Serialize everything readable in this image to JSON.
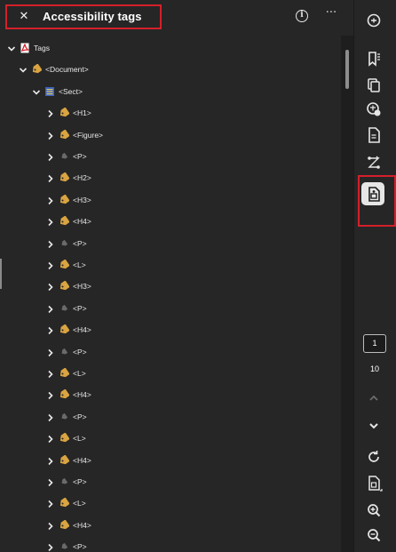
{
  "panel": {
    "title": "Accessibility tags",
    "close_icon": "close-icon",
    "info_icon": "info-icon",
    "info_glyph": "i",
    "more_icon": "more-options-icon",
    "more_glyph": "···",
    "highlight_color": "#d4202a"
  },
  "tree": {
    "rows": [
      {
        "label": "Tags",
        "icon": "pdf-tags-icon",
        "level": 0,
        "expanded": true
      },
      {
        "label": "<Document>",
        "icon": "tag-icon",
        "level": 1,
        "expanded": true
      },
      {
        "label": "<Sect>",
        "icon": "section-icon",
        "level": 2,
        "expanded": true
      },
      {
        "label": "<H1>",
        "icon": "tag-icon",
        "level": 3,
        "expanded": false
      },
      {
        "label": "<Figure>",
        "icon": "tag-icon",
        "level": 3,
        "expanded": false
      },
      {
        "label": "<P>",
        "icon": "tag-dim-icon",
        "level": 3,
        "expanded": false
      },
      {
        "label": "<H2>",
        "icon": "tag-icon",
        "level": 3,
        "expanded": false
      },
      {
        "label": "<H3>",
        "icon": "tag-icon",
        "level": 3,
        "expanded": false
      },
      {
        "label": "<H4>",
        "icon": "tag-icon",
        "level": 3,
        "expanded": false
      },
      {
        "label": "<P>",
        "icon": "tag-dim-icon",
        "level": 3,
        "expanded": false
      },
      {
        "label": "<L>",
        "icon": "tag-icon",
        "level": 3,
        "expanded": false
      },
      {
        "label": "<H3>",
        "icon": "tag-icon",
        "level": 3,
        "expanded": false
      },
      {
        "label": "<P>",
        "icon": "tag-dim-icon",
        "level": 3,
        "expanded": false
      },
      {
        "label": "<H4>",
        "icon": "tag-icon",
        "level": 3,
        "expanded": false
      },
      {
        "label": "<P>",
        "icon": "tag-dim-icon",
        "level": 3,
        "expanded": false
      },
      {
        "label": "<L>",
        "icon": "tag-icon",
        "level": 3,
        "expanded": false
      },
      {
        "label": "<H4>",
        "icon": "tag-icon",
        "level": 3,
        "expanded": false
      },
      {
        "label": "<P>",
        "icon": "tag-dim-icon",
        "level": 3,
        "expanded": false
      },
      {
        "label": "<L>",
        "icon": "tag-icon",
        "level": 3,
        "expanded": false
      },
      {
        "label": "<H4>",
        "icon": "tag-icon",
        "level": 3,
        "expanded": false
      },
      {
        "label": "<P>",
        "icon": "tag-dim-icon",
        "level": 3,
        "expanded": false
      },
      {
        "label": "<L>",
        "icon": "tag-icon",
        "level": 3,
        "expanded": false
      },
      {
        "label": "<H4>",
        "icon": "tag-icon",
        "level": 3,
        "expanded": false
      },
      {
        "label": "<P>",
        "icon": "tag-dim-icon",
        "level": 3,
        "expanded": false
      }
    ]
  },
  "toolbar": {
    "buttons": [
      {
        "name": "comment-icon"
      },
      {
        "name": "bookmarks-icon"
      },
      {
        "name": "copy-pages-icon"
      },
      {
        "name": "attachments-icon"
      },
      {
        "name": "document-properties-icon"
      },
      {
        "name": "order-icon"
      },
      {
        "name": "accessibility-tags-icon",
        "active": true
      }
    ],
    "page_current": "1",
    "page_total": "10",
    "nav_buttons": [
      {
        "name": "chevron-up-icon"
      },
      {
        "name": "chevron-down-icon"
      },
      {
        "name": "rotate-icon"
      },
      {
        "name": "page-fit-icon"
      },
      {
        "name": "zoom-in-icon"
      },
      {
        "name": "zoom-out-icon"
      }
    ]
  }
}
